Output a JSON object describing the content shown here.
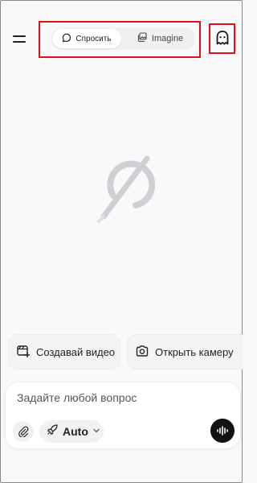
{
  "header": {
    "menu_icon": "menu-icon",
    "mode_tabs": [
      {
        "label": "Спросить",
        "icon": "chat-bubble-icon",
        "active": true
      },
      {
        "label": "Imagine",
        "icon": "image-stack-icon",
        "active": false
      }
    ],
    "ghost_icon": "ghost-icon",
    "highlight_color": "#e0101a"
  },
  "main": {
    "logo": "grok-logo-icon"
  },
  "suggestions": [
    {
      "label": "Создавай видео",
      "icon": "video-plus-icon"
    },
    {
      "label": "Открыть камеру",
      "icon": "camera-icon"
    }
  ],
  "composer": {
    "placeholder": "Задайте любой вопрос",
    "model_label": "Auto",
    "attach_icon": "paperclip-icon",
    "model_icon": "rocket-icon",
    "voice_icon": "voice-waveform-icon",
    "voice_button_color": "#121212"
  }
}
